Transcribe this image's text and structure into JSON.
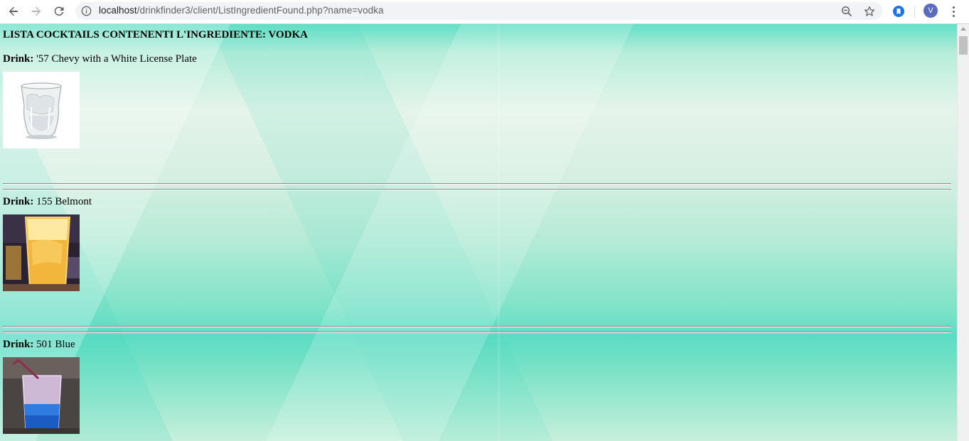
{
  "browser": {
    "url_host": "localhost",
    "url_path": "/drinkfinder3/client/ListIngredientFound.php?name=vodka",
    "profile_initial": "V",
    "icons": {
      "back": "back-arrow-icon",
      "forward": "forward-arrow-icon",
      "reload": "reload-icon",
      "site_info": "info-icon",
      "zoom": "zoom-out-icon",
      "bookmark": "star-icon",
      "extension": "bookmark-extension-icon",
      "menu": "kebab-menu-icon"
    }
  },
  "page": {
    "title": "LISTA COCKTAILS CONTENENTI L'INGREDIENTE: VODKA",
    "drink_label": "Drink:",
    "drinks": [
      {
        "name": "'57 Chevy with a White License Plate",
        "image": "rocks glass with ice"
      },
      {
        "name": "155 Belmont",
        "image": "tall glass with orange drink"
      },
      {
        "name": "501 Blue",
        "image": "glass with blue layered drink and straw"
      }
    ]
  },
  "colors": {
    "background_mint": "#b7ebd7",
    "background_teal": "#5cdcc4",
    "text": "#000000"
  }
}
